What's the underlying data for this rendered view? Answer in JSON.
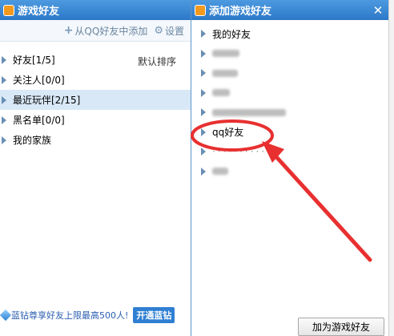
{
  "left_window": {
    "title": "游戏好友",
    "close": "✕",
    "toolbar": {
      "add_from_qq": "从QQ好友中添加",
      "settings": "设置"
    },
    "sort_label": "默认排序",
    "groups": [
      {
        "label": "好友[1/5]"
      },
      {
        "label": "关注人[0/0]"
      },
      {
        "label": "最近玩伴[2/15]"
      },
      {
        "label": "黑名单[0/0]"
      },
      {
        "label": "我的家族"
      }
    ],
    "promo_text": "蓝钻尊享好友上限最高500人!",
    "open_button": "开通蓝钻"
  },
  "right_window": {
    "title": "添加游戏好友",
    "close": "✕",
    "groups": [
      {
        "label": "我的好友"
      },
      {
        "label": ""
      },
      {
        "label": ""
      },
      {
        "label": ""
      },
      {
        "label": ""
      },
      {
        "label": "qq好友"
      },
      {
        "label": ""
      },
      {
        "label": ""
      }
    ],
    "add_button": "加为游戏好友"
  },
  "annotation": {
    "color": "#e83030"
  }
}
